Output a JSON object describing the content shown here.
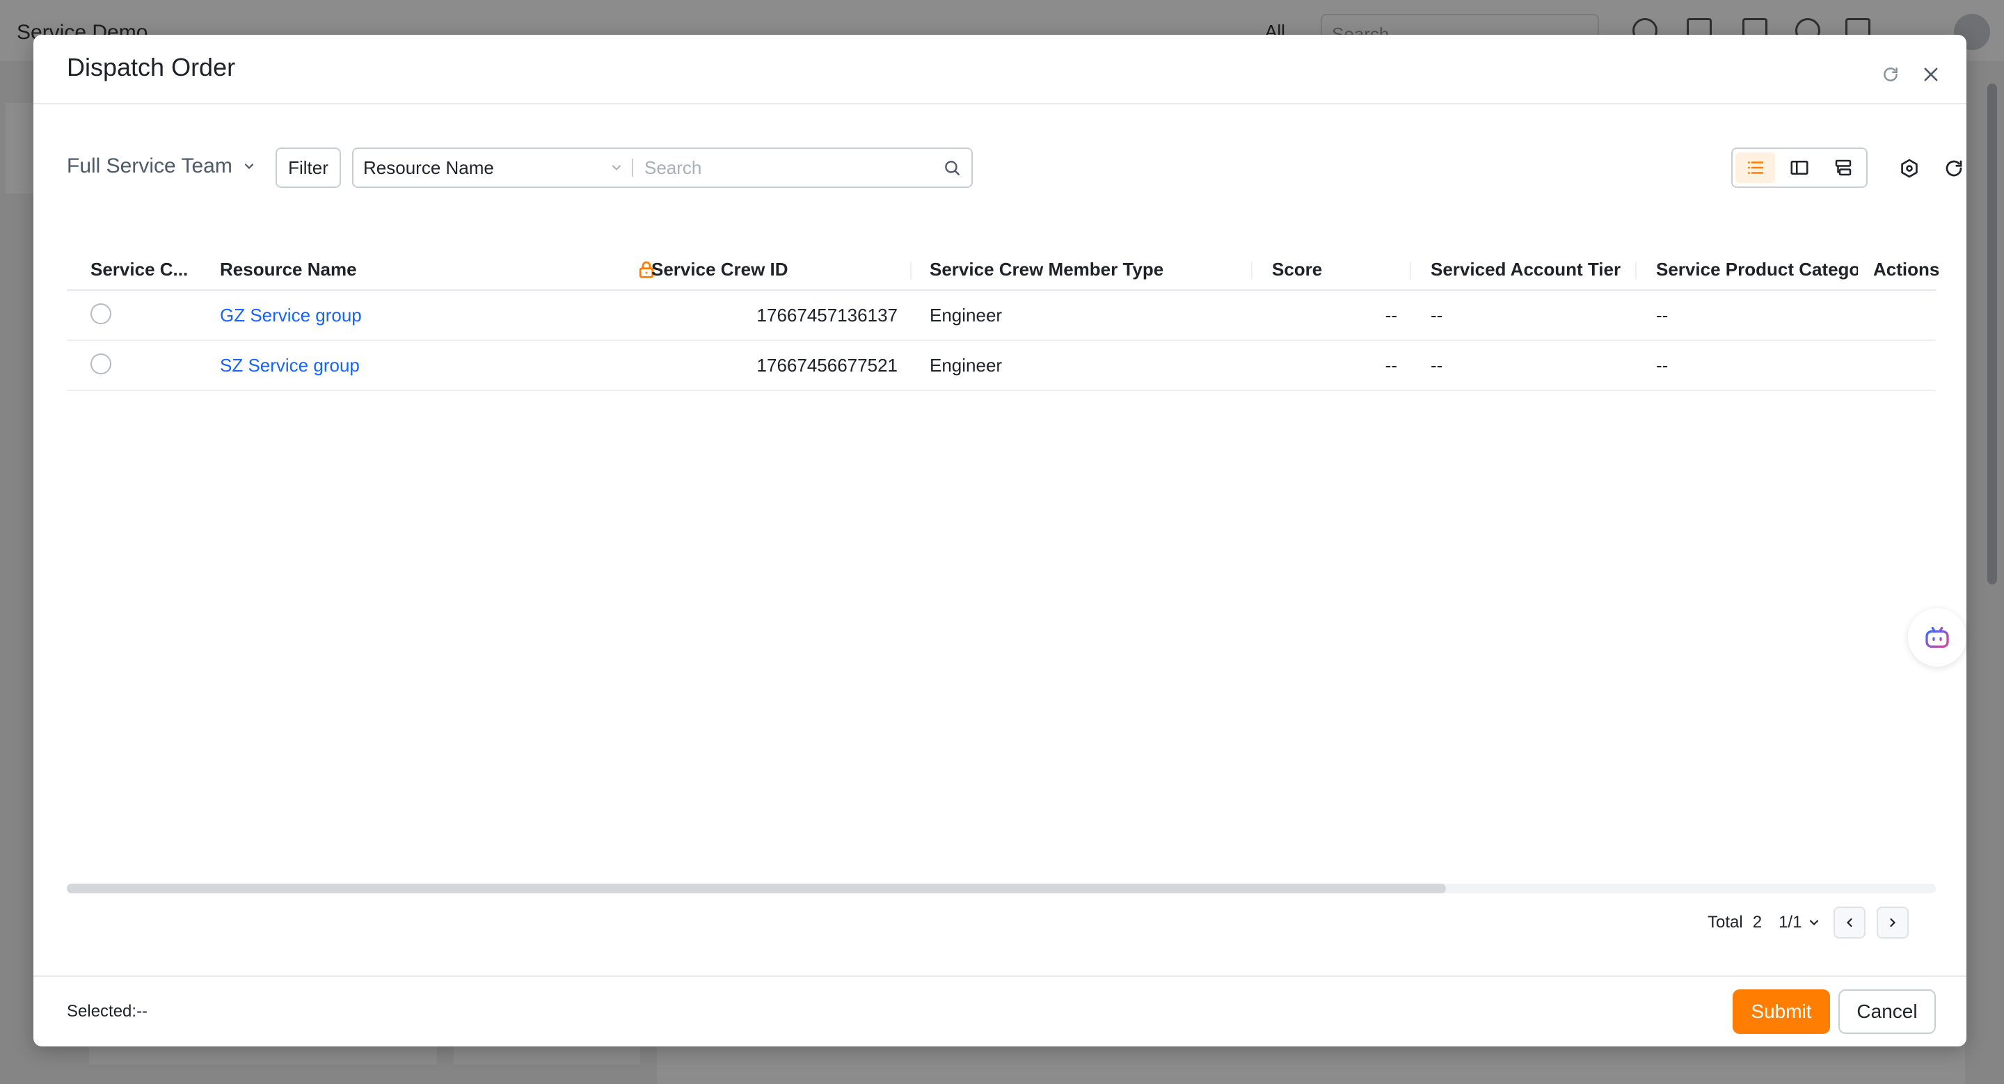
{
  "background": {
    "app_title": "Service Demo",
    "search_scope": "All",
    "search_placeholder": "Search"
  },
  "modal": {
    "title": "Dispatch Order",
    "refresh_icon": "refresh-icon",
    "close_icon": "close-icon"
  },
  "toolbar": {
    "team_select": "Full Service Team",
    "filter_label": "Filter",
    "search_field": "Resource Name",
    "search_placeholder": "Search",
    "view_modes": [
      "list-view-icon",
      "split-view-icon",
      "group-view-icon"
    ],
    "active_view": "list-view-icon"
  },
  "table": {
    "columns": [
      "Service C...",
      "Resource Name",
      "Service Crew ID",
      "Service Crew Member Type",
      "Score",
      "Serviced Account Tier",
      "Service Product Catego",
      "Actions"
    ],
    "rows": [
      {
        "resource_name": "GZ Service group",
        "crew_id": "17667457136137",
        "member_type": "Engineer",
        "score": "--",
        "account_tier": "--",
        "product_category": "--"
      },
      {
        "resource_name": "SZ Service group",
        "crew_id": "17667456677521",
        "member_type": "Engineer",
        "score": "--",
        "account_tier": "--",
        "product_category": "--"
      }
    ]
  },
  "pagination": {
    "total_label": "Total",
    "total": "2",
    "page": "1/1"
  },
  "footer": {
    "selected": "Selected:--",
    "submit_label": "Submit",
    "cancel_label": "Cancel"
  },
  "colors": {
    "accent": "#ff7d00",
    "link": "#1664ff"
  }
}
